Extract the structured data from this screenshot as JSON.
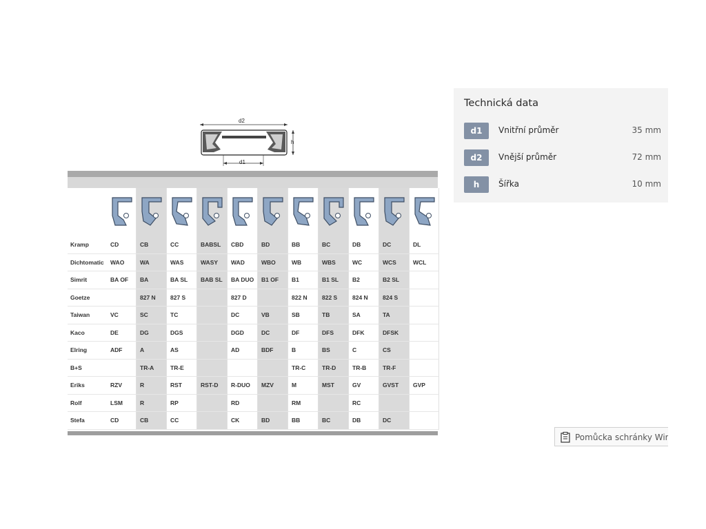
{
  "schematic": {
    "d2_label": "d2",
    "d1_label": "d1",
    "h_label": "h"
  },
  "xref": {
    "columns": 11,
    "rows": [
      {
        "brand": "Kramp",
        "cells": [
          "CD",
          "CB",
          "CC",
          "BABSL",
          "CBD",
          "BD",
          "BB",
          "BC",
          "DB",
          "DC",
          "DL"
        ]
      },
      {
        "brand": "Dichtomatic",
        "cells": [
          "WAO",
          "WA",
          "WAS",
          "WASY",
          "WAD",
          "WBO",
          "WB",
          "WBS",
          "WC",
          "WCS",
          "WCL"
        ]
      },
      {
        "brand": "Simrit",
        "cells": [
          "BA OF",
          "BA",
          "BA SL",
          "BAB SL",
          "BA DUO",
          "B1 OF",
          "B1",
          "B1 SL",
          "B2",
          "B2 SL",
          ""
        ]
      },
      {
        "brand": "Goetze",
        "cells": [
          "",
          "827 N",
          "827 S",
          "",
          "827 D",
          "",
          "822 N",
          "822 S",
          "824 N",
          "824 S",
          ""
        ]
      },
      {
        "brand": "Taiwan",
        "cells": [
          "VC",
          "SC",
          "TC",
          "",
          "DC",
          "VB",
          "SB",
          "TB",
          "SA",
          "TA",
          ""
        ]
      },
      {
        "brand": "Kaco",
        "cells": [
          "DE",
          "DG",
          "DGS",
          "",
          "DGD",
          "DC",
          "DF",
          "DFS",
          "DFK",
          "DFSK",
          ""
        ]
      },
      {
        "brand": "Elring",
        "cells": [
          "ADF",
          "A",
          "AS",
          "",
          "AD",
          "BDF",
          "B",
          "BS",
          "C",
          "CS",
          ""
        ]
      },
      {
        "brand": "B+S",
        "cells": [
          "",
          "TR-A",
          "TR-E",
          "",
          "",
          "",
          "TR-C",
          "TR-D",
          "TR-B",
          "TR-F",
          ""
        ]
      },
      {
        "brand": "Eriks",
        "cells": [
          "RZV",
          "R",
          "RST",
          "RST-D",
          "R-DUO",
          "MZV",
          "M",
          "MST",
          "GV",
          "GVST",
          "GVP"
        ]
      },
      {
        "brand": "Rolf",
        "cells": [
          "LSM",
          "R",
          "RP",
          "",
          "RD",
          "",
          "RM",
          "",
          "RC",
          "",
          ""
        ]
      },
      {
        "brand": "Stefa",
        "cells": [
          "CD",
          "CB",
          "CC",
          "",
          "CK",
          "BD",
          "BB",
          "BC",
          "DB",
          "DC",
          ""
        ]
      }
    ],
    "profile_icons": [
      "seal-profile-cd-icon",
      "seal-profile-cb-icon",
      "seal-profile-cc-icon",
      "seal-profile-babsl-icon",
      "seal-profile-cbd-icon",
      "seal-profile-bd-icon",
      "seal-profile-bb-icon",
      "seal-profile-bc-icon",
      "seal-profile-db-icon",
      "seal-profile-dc-icon",
      "seal-profile-dl-icon"
    ]
  },
  "tech": {
    "title": "Technická data",
    "rows": [
      {
        "badge": "d1",
        "label": "Vnitřní průměr",
        "value": "35 mm"
      },
      {
        "badge": "d2",
        "label": "Vnější průměr",
        "value": "72 mm"
      },
      {
        "badge": "h",
        "label": "Šířka",
        "value": "10 mm"
      }
    ]
  },
  "clipboard": {
    "text": "Pomůcka schránky Windows",
    "icon": "clipboard-icon"
  },
  "colors": {
    "badge": "#8391a5",
    "panel_bg": "#f3f3f3",
    "table_shade": "#dadada",
    "seal_blue": "#7f9bbd"
  }
}
